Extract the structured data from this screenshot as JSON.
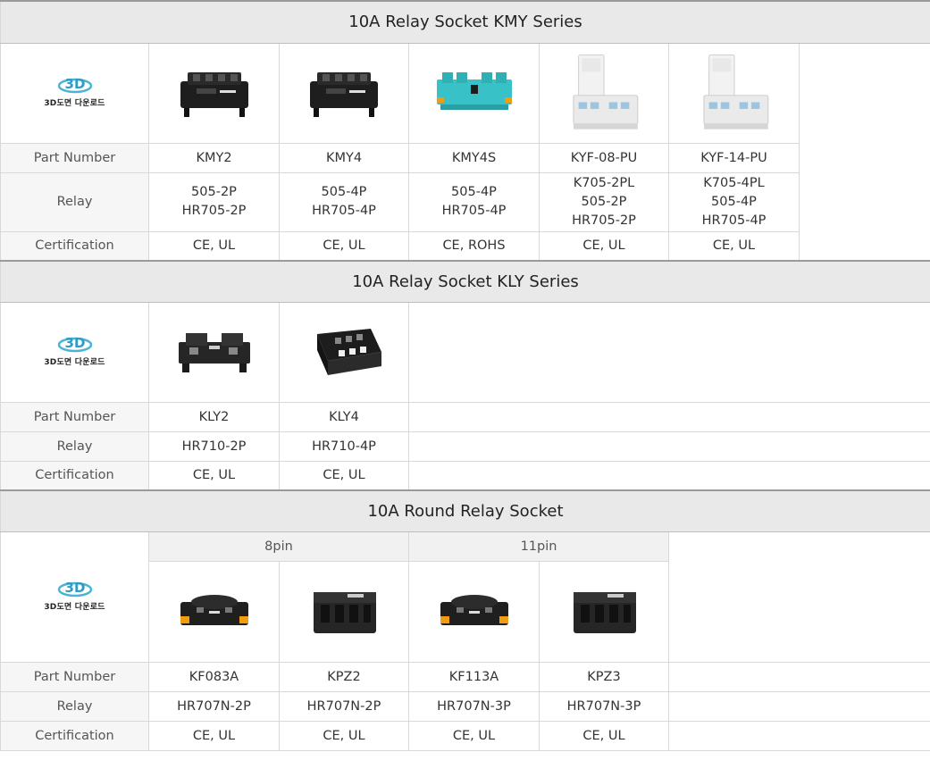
{
  "logo_text": "3D도면 다운로드",
  "labels": {
    "part_number": "Part Number",
    "relay": "Relay",
    "certification": "Certification"
  },
  "kmy": {
    "title": "10A Relay Socket KMY Series",
    "parts": [
      "KMY2",
      "KMY4",
      "KMY4S",
      "KYF-08-PU",
      "KYF-14-PU"
    ],
    "relays": [
      [
        "505-2P",
        "HR705-2P"
      ],
      [
        "505-4P",
        "HR705-4P"
      ],
      [
        "505-4P",
        "HR705-4P"
      ],
      [
        "K705-2PL",
        "505-2P",
        "HR705-2P"
      ],
      [
        "K705-4PL",
        "505-4P",
        "HR705-4P"
      ]
    ],
    "certs": [
      "CE, UL",
      "CE, UL",
      "CE, ROHS",
      "CE, UL",
      "CE, UL"
    ]
  },
  "kly": {
    "title": "10A Relay Socket KLY Series",
    "parts": [
      "KLY2",
      "KLY4"
    ],
    "relays": [
      "HR710-2P",
      "HR710-4P"
    ],
    "certs": [
      "CE, UL",
      "CE, UL"
    ]
  },
  "round": {
    "title": "10A Round Relay Socket",
    "groups": [
      "8pin",
      "11pin"
    ],
    "parts": [
      "KF083A",
      "KPZ2",
      "KF113A",
      "KPZ3"
    ],
    "relays": [
      "HR707N-2P",
      "HR707N-2P",
      "HR707N-3P",
      "HR707N-3P"
    ],
    "certs": [
      "CE, UL",
      "CE, UL",
      "CE, UL",
      "CE, UL"
    ]
  },
  "colors": {
    "header_bg": "#e9e9e9",
    "label_bg": "#f6f6f6",
    "border": "#d8d8d8",
    "logo_teal": "#3aa7c9"
  }
}
